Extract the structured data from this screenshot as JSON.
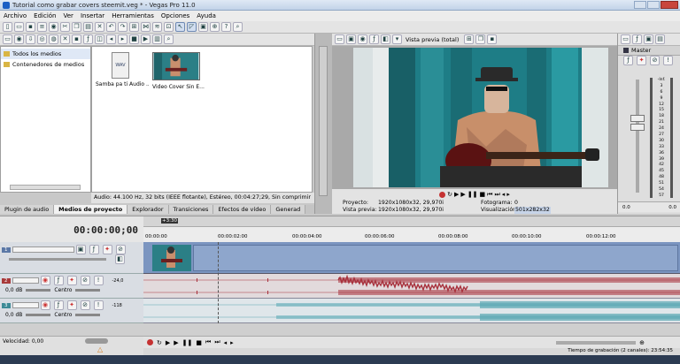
{
  "window": {
    "title": "Tutorial como grabar covers steemit.veg * - Vegas Pro 11.0"
  },
  "menu": [
    "Archivo",
    "Edición",
    "Ver",
    "Insertar",
    "Herramientas",
    "Opciones",
    "Ayuda"
  ],
  "media_panel": {
    "tree": [
      "Todos los medios",
      "Contenedores de medios"
    ],
    "items": [
      {
        "label": "Samba pa ti Audio ...",
        "icon": "wav-file-icon"
      },
      {
        "label": "Video Cover Sin E...",
        "icon": "video-thumbnail"
      }
    ],
    "info": "Audio: 44.100 Hz, 32 bits (IEEE flotante), Estéreo, 00:04:27;29, Sin comprimir",
    "tabs": [
      "Plugin de audio",
      "Medios de proyecto",
      "Explorador",
      "Transiciones",
      "Efectos de vídeo",
      "Generad"
    ]
  },
  "preview": {
    "mode": "Vista previa (total)",
    "proyecto_label": "Proyecto:",
    "proyecto_value": "1920x1080x32, 29,970i",
    "vista_label": "Vista previa:",
    "vista_value": "1920x1080x32, 29,970i",
    "fotograma_label": "Fotograma:",
    "fotograma_value": "0",
    "visualizacion_label": "Visualización:",
    "visualizacion_value": "501x282x32"
  },
  "mixer": {
    "label": "Master",
    "scale": [
      "-Inf.",
      "3",
      "6",
      "9",
      "12",
      "15",
      "18",
      "21",
      "24",
      "27",
      "30",
      "33",
      "36",
      "39",
      "42",
      "45",
      "48",
      "51",
      "54",
      "57"
    ],
    "bottom_left": "0.0",
    "bottom_right": "0.0"
  },
  "timeline": {
    "timecode": "00:00:00;00",
    "marker": "+3:30",
    "ruler": [
      "00:00:00",
      "00:00:02:00",
      "00:00:04:00",
      "00:00:06:00",
      "00:00:08:00",
      "00:00:10:00",
      "00:00:12:00"
    ],
    "tracks": [
      {
        "num": "1",
        "type": "video"
      },
      {
        "num": "2",
        "type": "audio",
        "db": "0,0 dB",
        "pan": "Centro",
        "meter": "-24,0"
      },
      {
        "num": "3",
        "type": "audio",
        "db": "0,0 dB",
        "pan": "Centro",
        "meter": "-118"
      }
    ],
    "velocidad": "Velocidad: 0,00"
  },
  "status": {
    "text": "Tiempo de grabación (2 canales): 23:54:35"
  },
  "colors": {
    "wave_red": "#a8323d",
    "wave_teal": "#5aa8b4",
    "video_track": "#7b95c0",
    "track_bg": "#dde3ec"
  }
}
